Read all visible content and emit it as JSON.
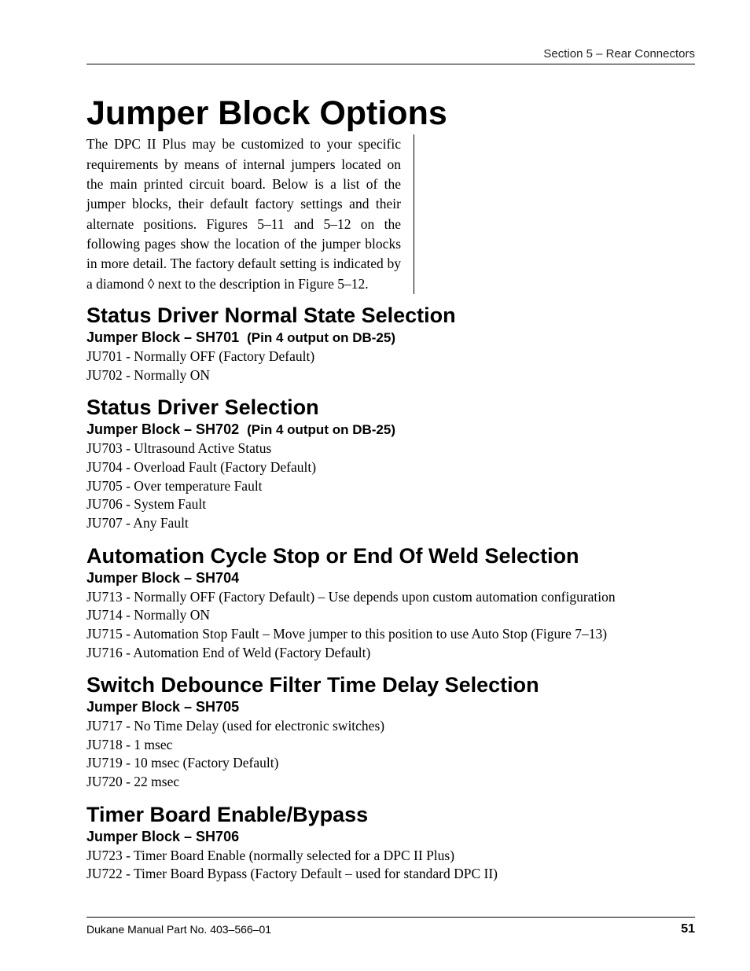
{
  "running_head": "Section 5 – Rear Connectors",
  "main_title": "Jumper Block Options",
  "intro": "The DPC II Plus may be customized to your specific requirements by means of internal jumpers located on the main printed circuit board. Below is a list of the jumper blocks, their default factory settings and their alternate positions. Figures 5–11 and 5–12 on the following pages show the location of the jumper blocks in more detail. The factory default setting is indicated by a diamond ◊ next to the description in Figure 5–12.",
  "sections": [
    {
      "title": "Status Driver Normal State Selection",
      "sub": "Jumper Block – SH701",
      "note": "(Pin 4 output on DB-25)",
      "items": [
        "JU701 - Normally OFF (Factory Default)",
        "JU702 - Normally ON"
      ]
    },
    {
      "title": "Status Driver Selection",
      "sub": "Jumper Block – SH702",
      "note": "(Pin 4 output on DB-25)",
      "items": [
        "JU703 - Ultrasound Active Status",
        "JU704 - Overload Fault (Factory Default)",
        "JU705 - Over temperature Fault",
        "JU706 - System Fault",
        "JU707 - Any Fault"
      ]
    },
    {
      "title": "Automation Cycle Stop or End Of Weld Selection",
      "sub": "Jumper Block – SH704",
      "note": "",
      "items": [
        "JU713 - Normally OFF (Factory Default) – Use depends upon custom automation configuration",
        "JU714 - Normally ON",
        "JU715 - Automation Stop Fault – Move jumper to this position to use Auto Stop (Figure 7–13)",
        "JU716 - Automation End of Weld (Factory Default)"
      ]
    },
    {
      "title": "Switch Debounce Filter Time Delay Selection",
      "sub": "Jumper Block – SH705",
      "note": "",
      "items": [
        "JU717 - No Time Delay (used for electronic switches)",
        "JU718 - 1 msec",
        "JU719 - 10 msec (Factory Default)",
        "JU720 - 22 msec"
      ]
    },
    {
      "title": "Timer Board Enable/Bypass",
      "sub": "Jumper Block – SH706",
      "note": "",
      "items": [
        "JU723 - Timer Board Enable (normally selected for a DPC II Plus)",
        "JU722 - Timer Board Bypass (Factory Default – used for standard DPC II)"
      ]
    }
  ],
  "footer_left": "Dukane Manual Part No. 403–566–01",
  "page_number": "51"
}
